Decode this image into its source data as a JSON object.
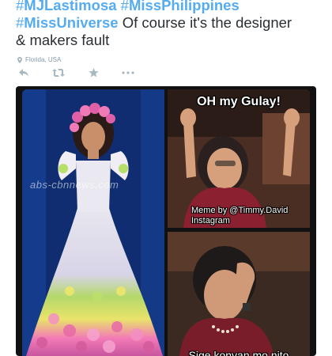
{
  "tweet": {
    "line1_tag1": "MJLastimosa",
    "line1_tag2": "MissPhilippines",
    "line2_tag": "MissUniverse",
    "line2_text": " Of course it's the designer",
    "line3_text": "& makers fault",
    "location": "Florida, USA"
  },
  "actions": [
    {
      "icon": "reply-icon"
    },
    {
      "icon": "retweet-icon"
    },
    {
      "icon": "favorite-icon"
    },
    {
      "icon": "more-icon"
    }
  ],
  "media": {
    "watermark": "abs-cbnnews.com",
    "meme_top": "OH my Gulay!",
    "meme_credit_1": "Meme by @Timmy.David",
    "meme_credit_2": "Instagram",
    "meme_bottom_partial": "Sige konyan mo nito"
  },
  "colors": {
    "hashtag": "#55acee",
    "text": "#292f33",
    "meta": "#8899a6",
    "icon": "#aab8c2"
  }
}
